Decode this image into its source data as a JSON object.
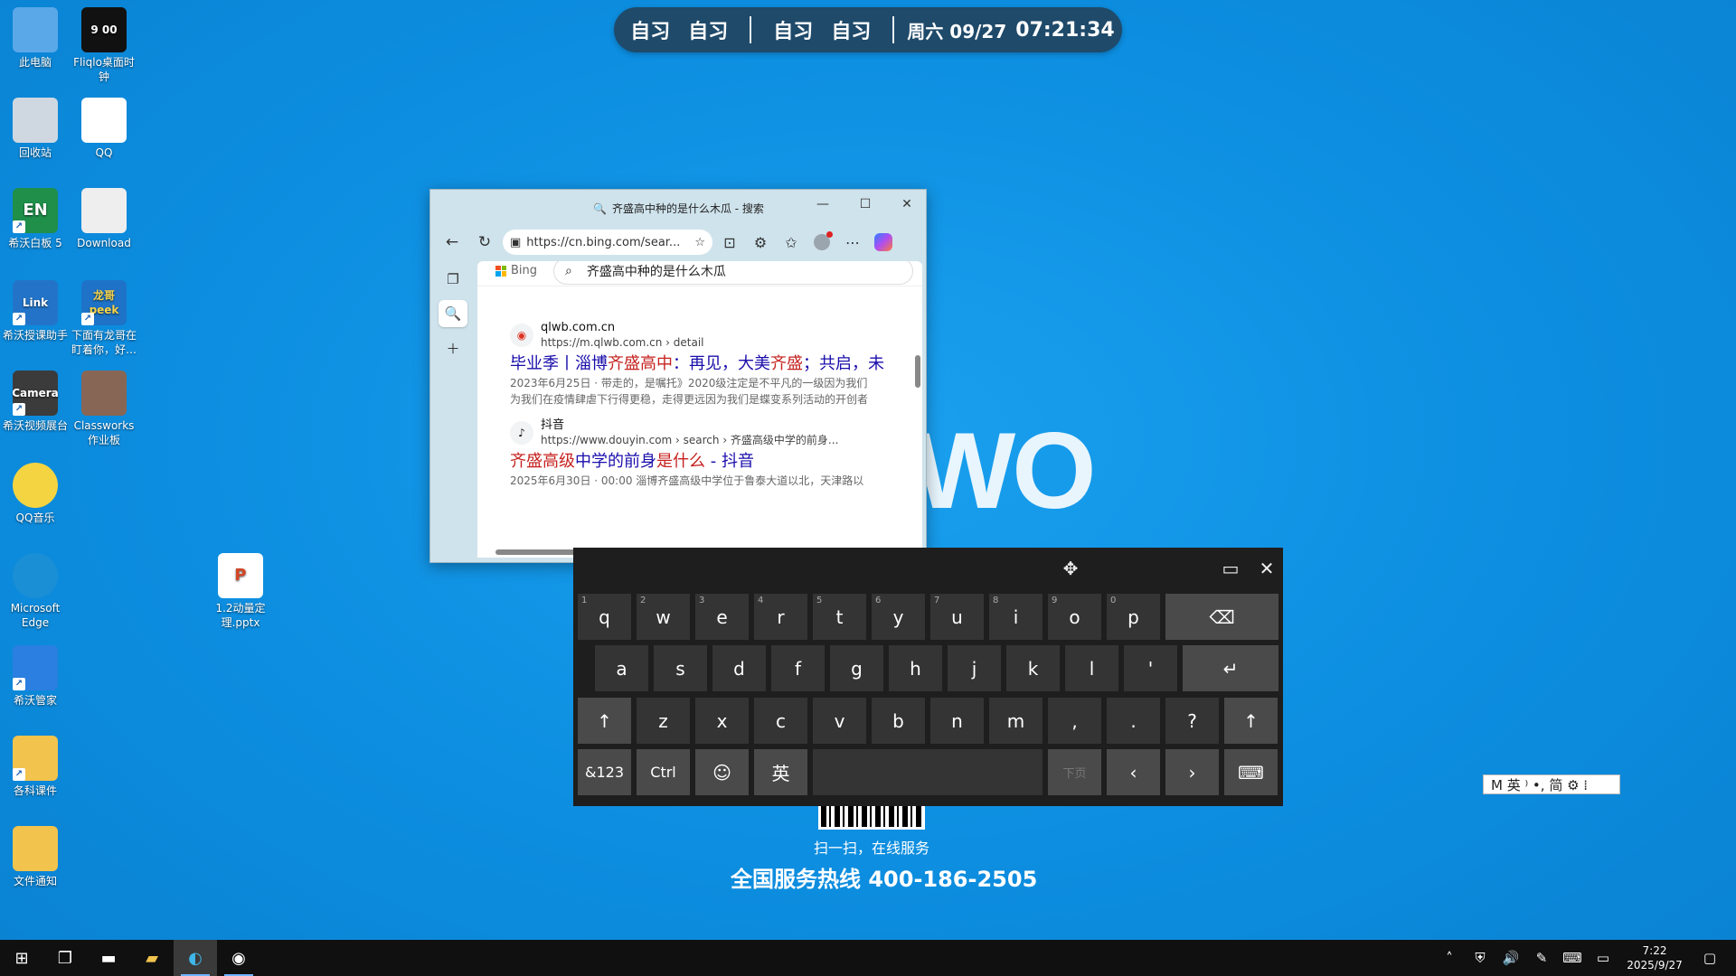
{
  "desktop": {
    "icons": [
      {
        "label": "此电脑",
        "icon": "computer-icon"
      },
      {
        "label": "Fliqlo桌面时钟",
        "icon": "flip-clock-icon",
        "glyph": "9 00"
      },
      {
        "label": "回收站",
        "icon": "recycle-bin-icon"
      },
      {
        "label": "QQ",
        "icon": "qq-penguin-icon"
      },
      {
        "label": "希沃白板 5",
        "icon": "seewo-whiteboard-icon",
        "glyph": "EN"
      },
      {
        "label": "Download",
        "icon": "anime-character-icon"
      },
      {
        "label": "希沃授课助手",
        "icon": "seewo-link-icon",
        "glyph": "Link"
      },
      {
        "label": "下面有龙哥在盯着你，好…",
        "icon": "longge-peek-icon",
        "glyph": "龙哥 peek"
      },
      {
        "label": "希沃视频展台",
        "icon": "seewo-camera-icon",
        "glyph": "Camera"
      },
      {
        "label": "Classworks 作业板",
        "icon": "person-photo-icon"
      },
      {
        "label": "QQ音乐",
        "icon": "qq-music-icon"
      },
      {
        "label": "Microsoft Edge",
        "icon": "edge-icon"
      },
      {
        "label": "1.2动量定理.pptx",
        "icon": "powerpoint-file-icon",
        "glyph": "P"
      },
      {
        "label": "希沃管家",
        "icon": "seewo-shield-icon"
      },
      {
        "label": "各科课件",
        "icon": "folder-icon"
      },
      {
        "label": "文件通知",
        "icon": "folder-warning-icon"
      }
    ]
  },
  "topbar": {
    "segments": [
      "自习",
      "自习",
      "自习",
      "自习"
    ],
    "date": "周六 09/27",
    "time": "07:21:34"
  },
  "wallpaper": {
    "brand": "WO",
    "scan_text": "扫一扫，在线服务",
    "hotline": "全国服务热线 400-186-2505"
  },
  "browser": {
    "title": "齐盛高中种的是什么木瓜 - 搜索",
    "url": "https://cn.bing.com/sear...",
    "search_query": "齐盛高中种的是什么木瓜",
    "bing_label": "Bing",
    "results": [
      {
        "site": "qlwb.com.cn",
        "url": "https://m.qlwb.com.cn › detail",
        "title_parts": [
          {
            "text": "毕业季丨淄博",
            "hl": false
          },
          {
            "text": "齐盛高中",
            "hl": true
          },
          {
            "text": "：再见，大美",
            "hl": false
          },
          {
            "text": "齐盛",
            "hl": true
          },
          {
            "text": "；共启，未",
            "hl": false
          }
        ],
        "snippet1": "2023年6月25日 · 带走的，是嘱托》2020级注定是不平凡的一级因为我们",
        "snippet2": "为我们在疫情肆虐下行得更稳，走得更远因为我们是蝶变系列活动的开创者"
      },
      {
        "site": "抖音",
        "url": "https://www.douyin.com › search › 齐盛高级中学的前身...",
        "title_parts": [
          {
            "text": "齐盛高级",
            "hl": true
          },
          {
            "text": "中学的前身",
            "hl": false
          },
          {
            "text": "是什么",
            "hl": true
          },
          {
            "text": " - 抖音",
            "hl": false
          }
        ],
        "snippet1": "2025年6月30日 · 00:00 淄博齐盛高级中学位于鲁泰大道以北，天津路以",
        "snippet2": ""
      }
    ]
  },
  "keyboard": {
    "row1": [
      {
        "k": "q",
        "n": "1"
      },
      {
        "k": "w",
        "n": "2"
      },
      {
        "k": "e",
        "n": "3"
      },
      {
        "k": "r",
        "n": "4"
      },
      {
        "k": "t",
        "n": "5"
      },
      {
        "k": "y",
        "n": "6"
      },
      {
        "k": "u",
        "n": "7"
      },
      {
        "k": "i",
        "n": "8"
      },
      {
        "k": "o",
        "n": "9"
      },
      {
        "k": "p",
        "n": "0"
      }
    ],
    "row2": [
      "a",
      "s",
      "d",
      "f",
      "g",
      "h",
      "j",
      "k",
      "l",
      "'"
    ],
    "row3": [
      "z",
      "x",
      "c",
      "v",
      "b",
      "n",
      "m",
      ",",
      ".",
      "?"
    ],
    "backspace": "⌫",
    "enter": "↵",
    "shift": "↑",
    "sym": "&123",
    "ctrl": "Ctrl",
    "emoji": "☺",
    "lang": "英",
    "next_page": "下页",
    "left": "‹",
    "right": "›"
  },
  "ime": {
    "text": "M 英 ⁾ •, 简 ⚙ ⁞"
  },
  "taskbar": {
    "clock_time": "7:22",
    "clock_date": "2025/9/27"
  }
}
